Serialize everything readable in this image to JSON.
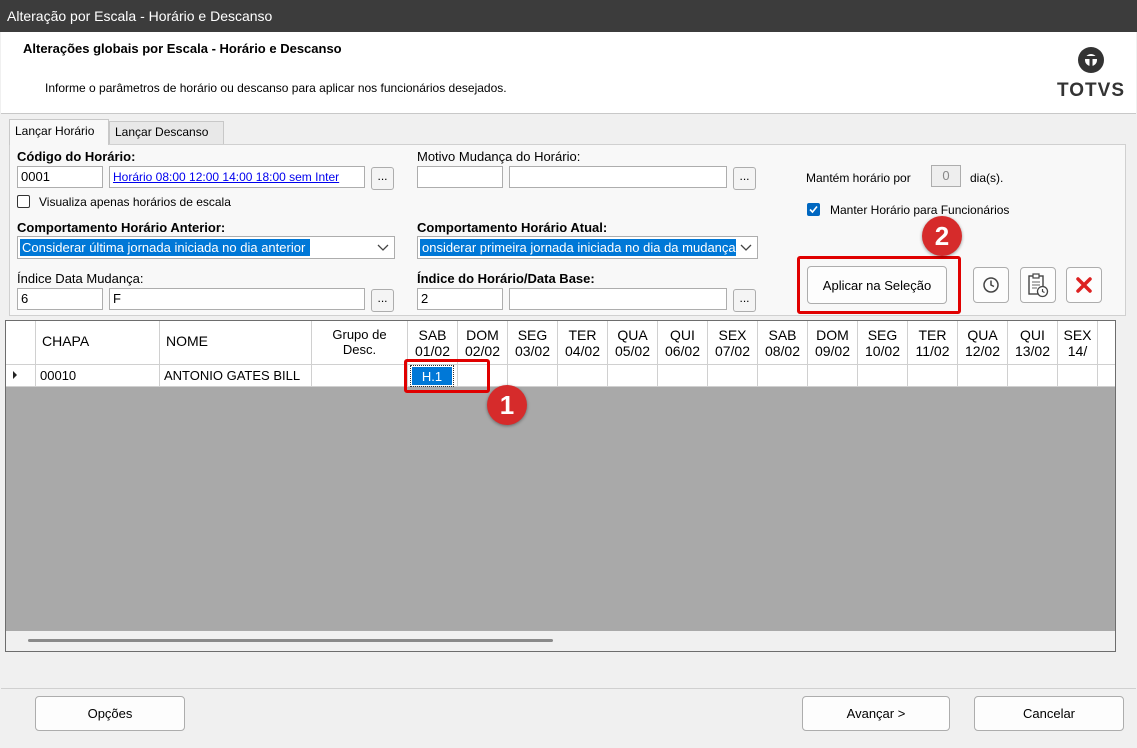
{
  "window": {
    "title": "Alteração por Escala - Horário e Descanso"
  },
  "header": {
    "title": "Alterações globais por Escala - Horário e Descanso",
    "subtitle": "Informe o parâmetros de horário ou descanso para aplicar nos funcionários desejados.",
    "logo_text": "TOTVS"
  },
  "tabs": [
    {
      "label": "Lançar Horário",
      "active": true
    },
    {
      "label": "Lançar Descanso",
      "active": false
    }
  ],
  "form": {
    "codigo_label": "Código do Horário:",
    "codigo_value": "0001",
    "codigo_desc": "Horário 08:00 12:00 14:00 18:00 sem Inter",
    "dots": "...",
    "visualiza_label": "Visualiza apenas horários de escala",
    "visualiza_checked": false,
    "motivo_label": "Motivo Mudança do Horário:",
    "motivo_code": "",
    "motivo_desc": "",
    "mantem_label": "Mantém horário por",
    "mantem_value": "0",
    "mantem_unit": "dia(s).",
    "manter_label": "Manter Horário para Funcionários",
    "manter_checked": true,
    "comp_anterior_label": "Comportamento Horário Anterior:",
    "comp_anterior_value": "Considerar última jornada iniciada no dia anterior",
    "comp_atual_label": "Comportamento Horário Atual:",
    "comp_atual_value": "onsiderar primeira jornada iniciada no dia da mudança",
    "indice_data_label": "Índice Data Mudança:",
    "indice_data_value": "6",
    "indice_data_desc": "F",
    "indice_horario_label": "Índice do Horário/Data Base:",
    "indice_horario_value": "2",
    "indice_horario_desc": "",
    "aplicar_label": "Aplicar na Seleção"
  },
  "annotations": {
    "badge1": "1",
    "badge2": "2"
  },
  "grid": {
    "columns": [
      {
        "l1": "CHAPA",
        "l2": ""
      },
      {
        "l1": "NOME",
        "l2": ""
      },
      {
        "l1": "Grupo de",
        "l2": "Desc."
      },
      {
        "l1": "SAB",
        "l2": "01/02"
      },
      {
        "l1": "DOM",
        "l2": "02/02"
      },
      {
        "l1": "SEG",
        "l2": "03/02"
      },
      {
        "l1": "TER",
        "l2": "04/02"
      },
      {
        "l1": "QUA",
        "l2": "05/02"
      },
      {
        "l1": "QUI",
        "l2": "06/02"
      },
      {
        "l1": "SEX",
        "l2": "07/02"
      },
      {
        "l1": "SAB",
        "l2": "08/02"
      },
      {
        "l1": "DOM",
        "l2": "09/02"
      },
      {
        "l1": "SEG",
        "l2": "10/02"
      },
      {
        "l1": "TER",
        "l2": "11/02"
      },
      {
        "l1": "QUA",
        "l2": "12/02"
      },
      {
        "l1": "QUI",
        "l2": "13/02"
      },
      {
        "l1": "SEX",
        "l2": "14/"
      }
    ],
    "rows": [
      {
        "chapa": "00010",
        "nome": "ANTONIO GATES BILL",
        "grupo": "",
        "sab0102": "H.1"
      }
    ]
  },
  "footer": {
    "opcoes": "Opções",
    "avancar": "Avançar >",
    "cancelar": "Cancelar"
  },
  "colors": {
    "selection": "#0078d7",
    "highlight": "#e00000",
    "badge": "#d62b2b"
  }
}
